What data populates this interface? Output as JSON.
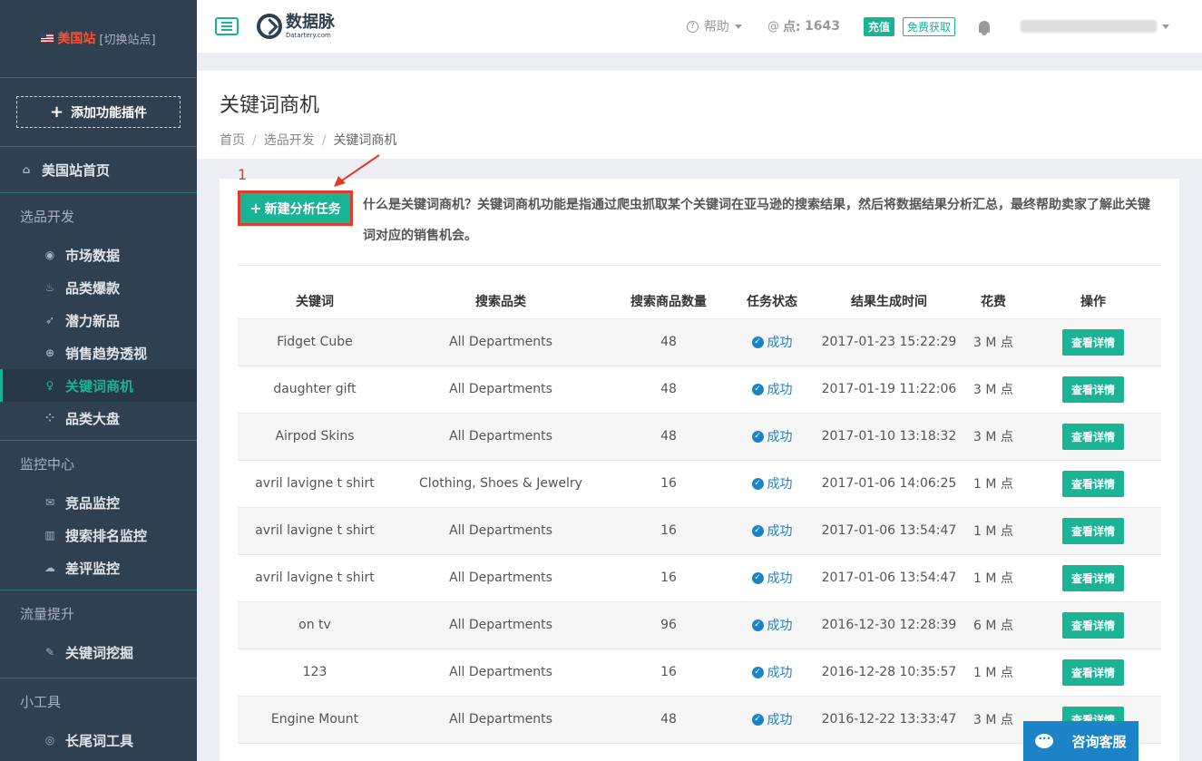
{
  "sidebar": {
    "site_name": "美国站",
    "site_toggle": "[切换站点]",
    "add_plugin": "添加功能插件",
    "home": "美国站首页",
    "sections": [
      {
        "title": "选品开发",
        "items": [
          "市场数据",
          "品类爆款",
          "潜力新品",
          "销售趋势透视",
          "关键词商机",
          "品类大盘"
        ]
      },
      {
        "title": "监控中心",
        "items": [
          "竞品监控",
          "搜索排名监控",
          "差评监控"
        ]
      },
      {
        "title": "流量提升",
        "items": [
          "关键词挖掘"
        ]
      },
      {
        "title": "小工具",
        "items": [
          "长尾词工具"
        ]
      }
    ]
  },
  "topnav": {
    "logo_cn": "数据脉",
    "logo_en": "Datartery.com",
    "help": "帮助",
    "points_label": "点:",
    "points_value": "1643",
    "recharge": "充值",
    "free": "免费获取"
  },
  "page": {
    "title": "关键词商机",
    "breadcrumb": [
      "首页",
      "选品开发",
      "关键词商机"
    ]
  },
  "intro": {
    "marker": "1",
    "new_task": "新建分析任务",
    "text": "什么是关键词商机？关键词商机功能是指通过爬虫抓取某个关键词在亚马逊的搜索结果，然后将数据结果分析汇总，最终帮助卖家了解此关键词对应的销售机会。"
  },
  "table": {
    "headers": [
      "关键词",
      "搜索品类",
      "搜索商品数量",
      "任务状态",
      "结果生成时间",
      "花费",
      "操作"
    ],
    "rows": [
      {
        "keyword": "Fidget Cube",
        "category": "All Departments",
        "count": "48",
        "status": "成功",
        "time": "2017-01-23 15:22:29",
        "cost": "3 M 点",
        "action": "查看详情"
      },
      {
        "keyword": "daughter gift",
        "category": "All Departments",
        "count": "48",
        "status": "成功",
        "time": "2017-01-19 11:22:06",
        "cost": "3 M 点",
        "action": "查看详情"
      },
      {
        "keyword": "Airpod Skins",
        "category": "All Departments",
        "count": "48",
        "status": "成功",
        "time": "2017-01-10 13:18:32",
        "cost": "3 M 点",
        "action": "查看详情"
      },
      {
        "keyword": "avril lavigne t shirt",
        "category": "Clothing, Shoes & Jewelry",
        "count": "16",
        "status": "成功",
        "time": "2017-01-06 14:06:25",
        "cost": "1 M 点",
        "action": "查看详情"
      },
      {
        "keyword": "avril lavigne t shirt",
        "category": "All Departments",
        "count": "16",
        "status": "成功",
        "time": "2017-01-06 13:54:47",
        "cost": "1 M 点",
        "action": "查看详情"
      },
      {
        "keyword": "avril lavigne t shirt",
        "category": "All Departments",
        "count": "16",
        "status": "成功",
        "time": "2017-01-06 13:54:47",
        "cost": "1 M 点",
        "action": "查看详情"
      },
      {
        "keyword": "on tv",
        "category": "All Departments",
        "count": "96",
        "status": "成功",
        "time": "2016-12-30 12:28:39",
        "cost": "6 M 点",
        "action": "查看详情"
      },
      {
        "keyword": "123",
        "category": "All Departments",
        "count": "16",
        "status": "成功",
        "time": "2016-12-28 10:35:57",
        "cost": "1 M 点",
        "action": "查看详情"
      },
      {
        "keyword": "Engine Mount",
        "category": "All Departments",
        "count": "48",
        "status": "成功",
        "time": "2016-12-22 13:33:47",
        "cost": "3 M 点",
        "action": "查看详情"
      }
    ]
  },
  "chat": "咨询客服"
}
